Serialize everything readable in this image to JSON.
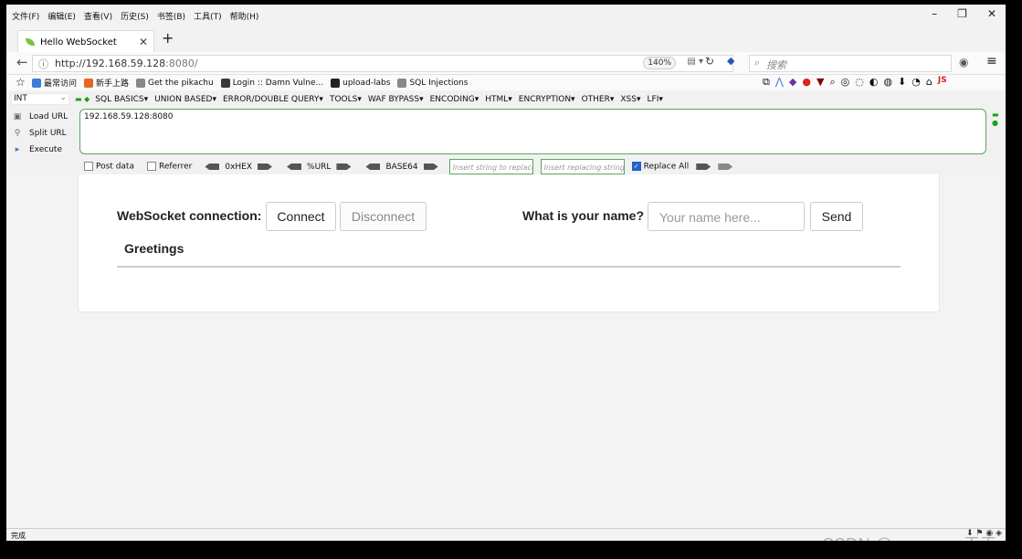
{
  "menubar": {
    "items": [
      "文件(F)",
      "编辑(E)",
      "查看(V)",
      "历史(S)",
      "书签(B)",
      "工具(T)",
      "帮助(H)"
    ],
    "minimize": "–",
    "restore": "❐",
    "close": "✕"
  },
  "tab": {
    "title": "Hello WebSocket",
    "close": "✕",
    "new_tab": "+"
  },
  "navbar": {
    "url_host": "http://192.168.59.128",
    "url_port": ":8080/",
    "zoom": "140%",
    "search_placeholder": "搜索"
  },
  "bookmarks": [
    {
      "label": "最常访问",
      "icon": "page-icon",
      "color": "#3d7bd6"
    },
    {
      "label": "新手上路",
      "icon": "firefox-icon",
      "color": "#e8661c"
    },
    {
      "label": "Get the pikachu",
      "icon": "globe-icon",
      "color": "#888888"
    },
    {
      "label": "Login :: Damn Vulne...",
      "icon": "dvwa-icon",
      "color": "#3b3b3b"
    },
    {
      "label": "upload-labs",
      "icon": "folder-icon",
      "color": "#222222"
    },
    {
      "label": "SQL Injections",
      "icon": "globe-icon",
      "color": "#888888"
    }
  ],
  "hackbar": {
    "select_value": "INT",
    "menu": [
      "SQL BASICS▾",
      "UNION BASED▾",
      "ERROR/DOUBLE QUERY▾",
      "TOOLS▾",
      "WAF BYPASS▾",
      "ENCODING▾",
      "HTML▾",
      "ENCRYPTION▾",
      "OTHER▾",
      "XSS▾",
      "LFI▾"
    ],
    "load_url": "Load URL",
    "split_url": "Split URL",
    "execute": "Execute",
    "url_value": "192.168.59.128:8080",
    "post_data": "Post data",
    "referrer": "Referrer",
    "hex": "0xHEX",
    "url_enc": "%URL",
    "base64": "BASE64",
    "replace_placeholder": "Insert string to replace",
    "replacing_placeholder": "Insert replacing string",
    "replace_all": "Replace All",
    "replace_all_checked": true
  },
  "app": {
    "ws_label": "WebSocket connection:",
    "connect": "Connect",
    "disconnect": "Disconnect",
    "name_label": "What is your name?",
    "name_placeholder": "Your name here...",
    "send": "Send",
    "greetings": "Greetings"
  },
  "status": {
    "text": "完成"
  },
  "watermark": "CSDN @mooyuan天天"
}
